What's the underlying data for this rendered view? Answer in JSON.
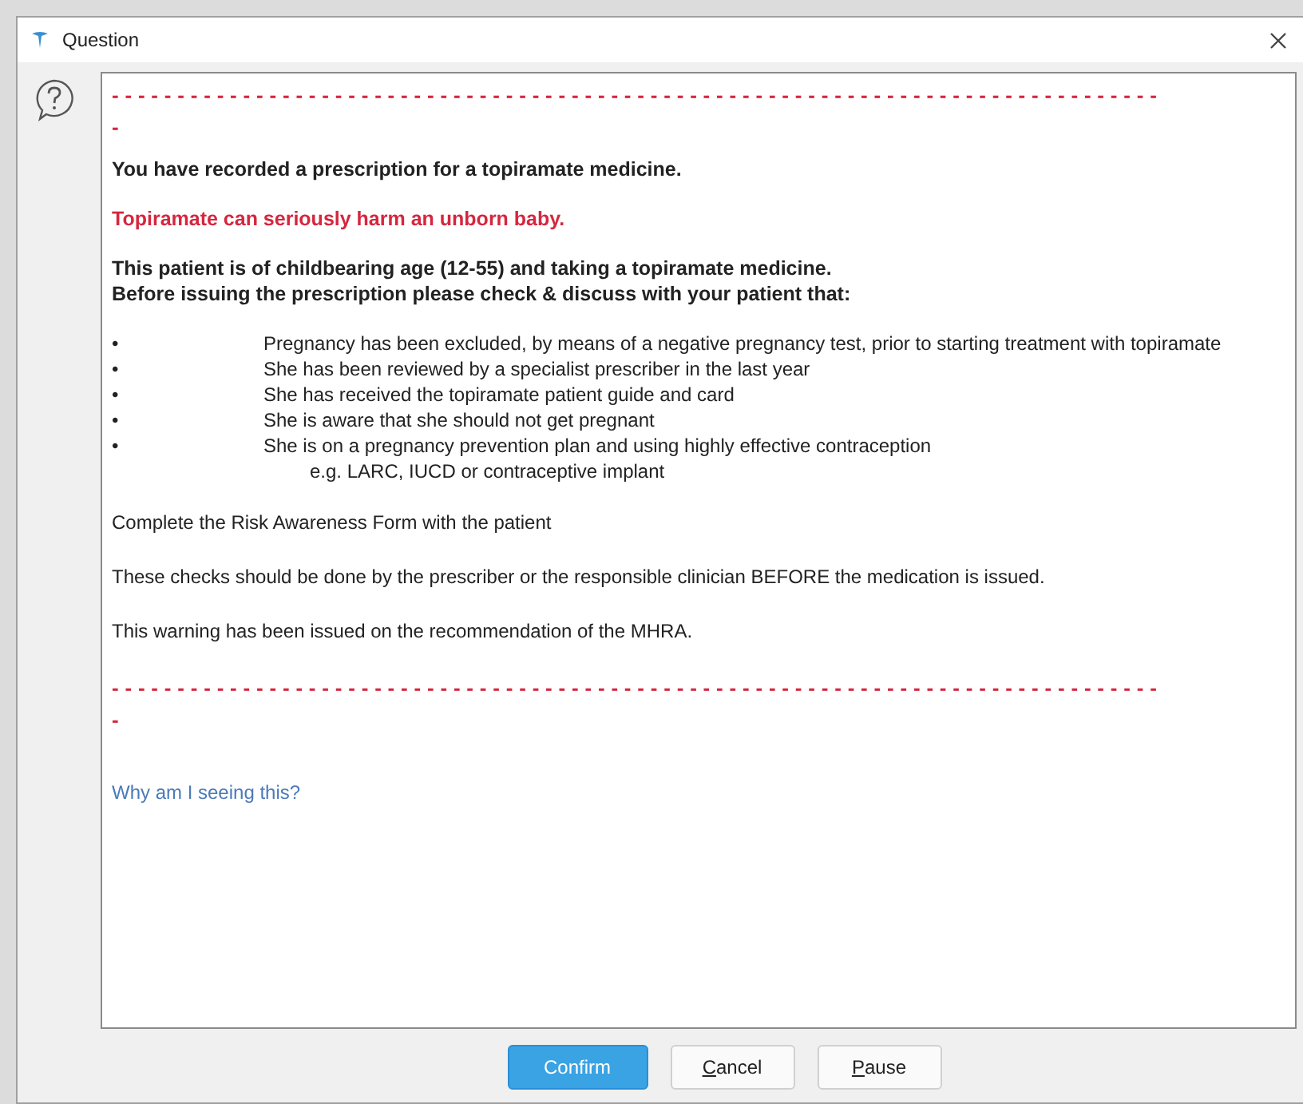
{
  "window": {
    "title": "Question"
  },
  "message": {
    "divider": "--------------------------------------------------------------------------------",
    "divider_tail": "-",
    "blocks": [
      {
        "kind": "bold",
        "text": "You have recorded a prescription for a topiramate medicine."
      },
      {
        "kind": "alert",
        "text": "Topiramate can seriously harm an unborn baby."
      },
      {
        "kind": "bold",
        "text": "This patient is of childbearing age (12-55) and taking a topiramate medicine.\nBefore issuing the prescription please check & discuss with your patient that:"
      },
      {
        "kind": "bullets",
        "items": [
          {
            "bullet": "•",
            "text": "Pregnancy has been excluded, by means of a negative pregnancy test, prior to starting treatment with topiramate"
          },
          {
            "bullet": "•",
            "text": "She has been reviewed by a specialist prescriber in the last year"
          },
          {
            "bullet": "•",
            "text": "She has received the topiramate patient guide and card"
          },
          {
            "bullet": "•",
            "text": "She is aware that she should not get pregnant"
          },
          {
            "bullet": "•",
            "text": "She is on a pregnancy prevention plan and using highly effective contraception",
            "note": "e.g. LARC, IUCD or contraceptive implant"
          }
        ]
      },
      {
        "kind": "plain",
        "text": "Complete the Risk Awareness Form with the patient"
      },
      {
        "kind": "plain",
        "text": "These checks should be done by the prescriber or the responsible clinician BEFORE the medication is issued."
      },
      {
        "kind": "plain",
        "text": "This warning has been issued on the recommendation of the MHRA."
      }
    ],
    "link": "Why am I seeing this?"
  },
  "buttons": [
    {
      "label": "Confirm",
      "primary": true
    },
    {
      "label": "Cancel",
      "primary": false
    },
    {
      "label": "Pause",
      "primary": false
    }
  ]
}
